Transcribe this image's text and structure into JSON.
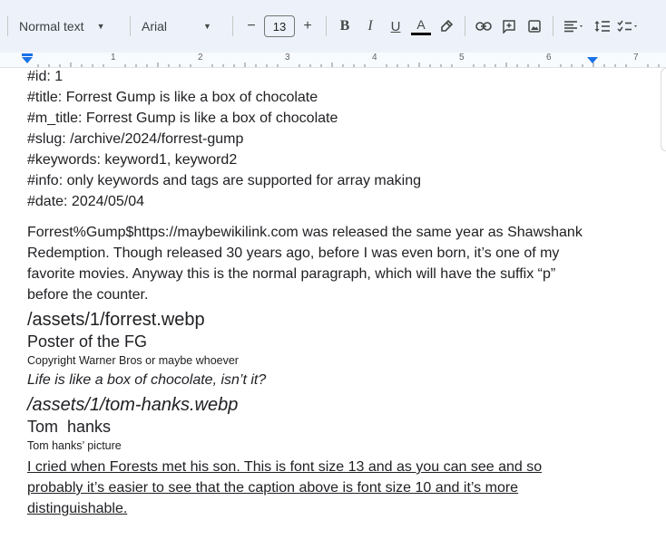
{
  "toolbar": {
    "style_select": "Normal text",
    "font_select": "Arial",
    "font_size": "13",
    "decrease_label": "−",
    "increase_label": "+",
    "bold_label": "B",
    "italic_label": "I",
    "underline_label": "U",
    "text_color_label": "A"
  },
  "ruler": {
    "numbers": [
      "1",
      "2",
      "3",
      "4",
      "5",
      "6",
      "7"
    ]
  },
  "document": {
    "meta": [
      "#id: 1",
      "#title: Forrest Gump is like a box of chocolate",
      "#m_title: Forrest Gump is like a box of chocolate",
      "#slug: /archive/2024/forrest-gump",
      "#keywords: keyword1, keyword2",
      "#info: only keywords and tags are supported for array making",
      "#date: 2024/05/04"
    ],
    "paragraph": "Forrest%Gump$https://maybewikilink.com was released the same year as Shawshank Redemption. Though released 30 years ago, before I was even born, it’s one of my favorite movies. Anyway this is the normal paragraph, which will have the suffix “p” before the counter.",
    "image1_path": "/assets/1/forrest.webp",
    "image1_title": "Poster of the FG",
    "image1_caption": "Copyright Warner Bros or maybe whoever",
    "quote": "Life is like a box of chocolate, isn’t it?",
    "image2_path": "/assets/1/tom-hanks.webp",
    "image2_title": "Tom  hanks",
    "image2_caption": "Tom hanks’ picture",
    "underlined_paragraph": "I cried when Forests met his son. This is font size 13 and as you can see and so probably it’s easier to see  that the caption above is font size 10 and it’s more distinguishable."
  }
}
